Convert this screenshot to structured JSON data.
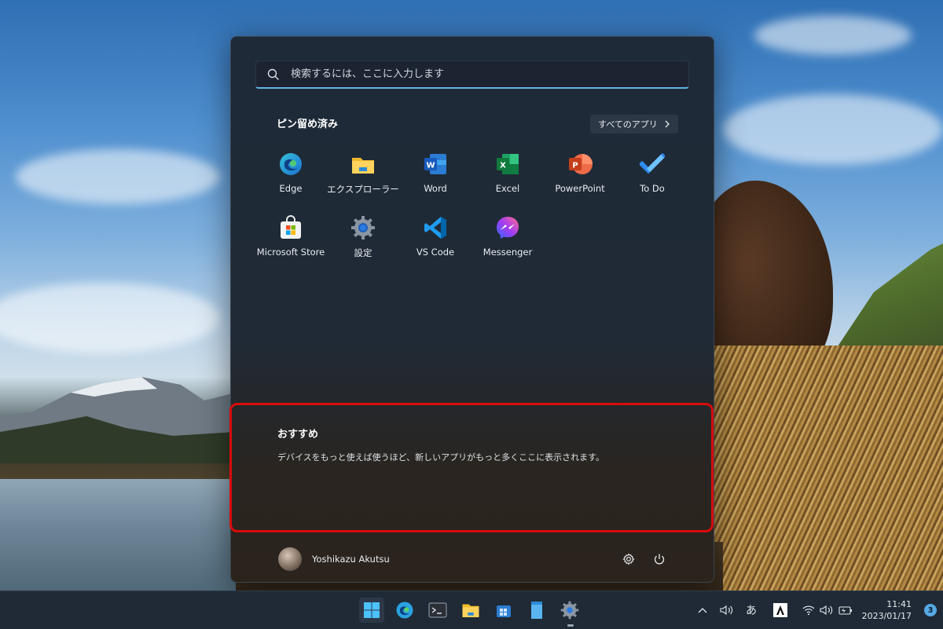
{
  "start_menu": {
    "search": {
      "placeholder": "検索するには、ここに入力します"
    },
    "pinned": {
      "title": "ピン留め済み",
      "all_apps_label": "すべてのアプリ",
      "apps": [
        {
          "label": "Edge",
          "icon": "edge-icon"
        },
        {
          "label": "エクスプローラー",
          "icon": "file-explorer-icon"
        },
        {
          "label": "Word",
          "icon": "word-icon"
        },
        {
          "label": "Excel",
          "icon": "excel-icon"
        },
        {
          "label": "PowerPoint",
          "icon": "powerpoint-icon"
        },
        {
          "label": "To Do",
          "icon": "todo-icon"
        },
        {
          "label": "Microsoft Store",
          "icon": "store-icon"
        },
        {
          "label": "設定",
          "icon": "settings-icon"
        },
        {
          "label": "VS Code",
          "icon": "vscode-icon"
        },
        {
          "label": "Messenger",
          "icon": "messenger-icon"
        }
      ]
    },
    "recommended": {
      "title": "おすすめ",
      "text": "デバイスをもっと使えば使うほど、新しいアプリがもっと多くここに表示されます。"
    },
    "footer": {
      "user_name": "Yoshikazu Akutsu"
    }
  },
  "taskbar": {
    "apps": [
      "start-icon",
      "edge-icon",
      "terminal-icon",
      "file-explorer-icon",
      "store-bag-icon",
      "notepad-icon",
      "settings-icon"
    ],
    "ime_label": "あ",
    "clock": {
      "time": "11:41",
      "date": "2023/01/17"
    },
    "notification_count": "3"
  },
  "colors": {
    "accent": "#63b3e4",
    "highlight_border": "#d80c0c",
    "menu_bg": "#1e2a38",
    "taskbar_bg": "#1f2a36"
  }
}
